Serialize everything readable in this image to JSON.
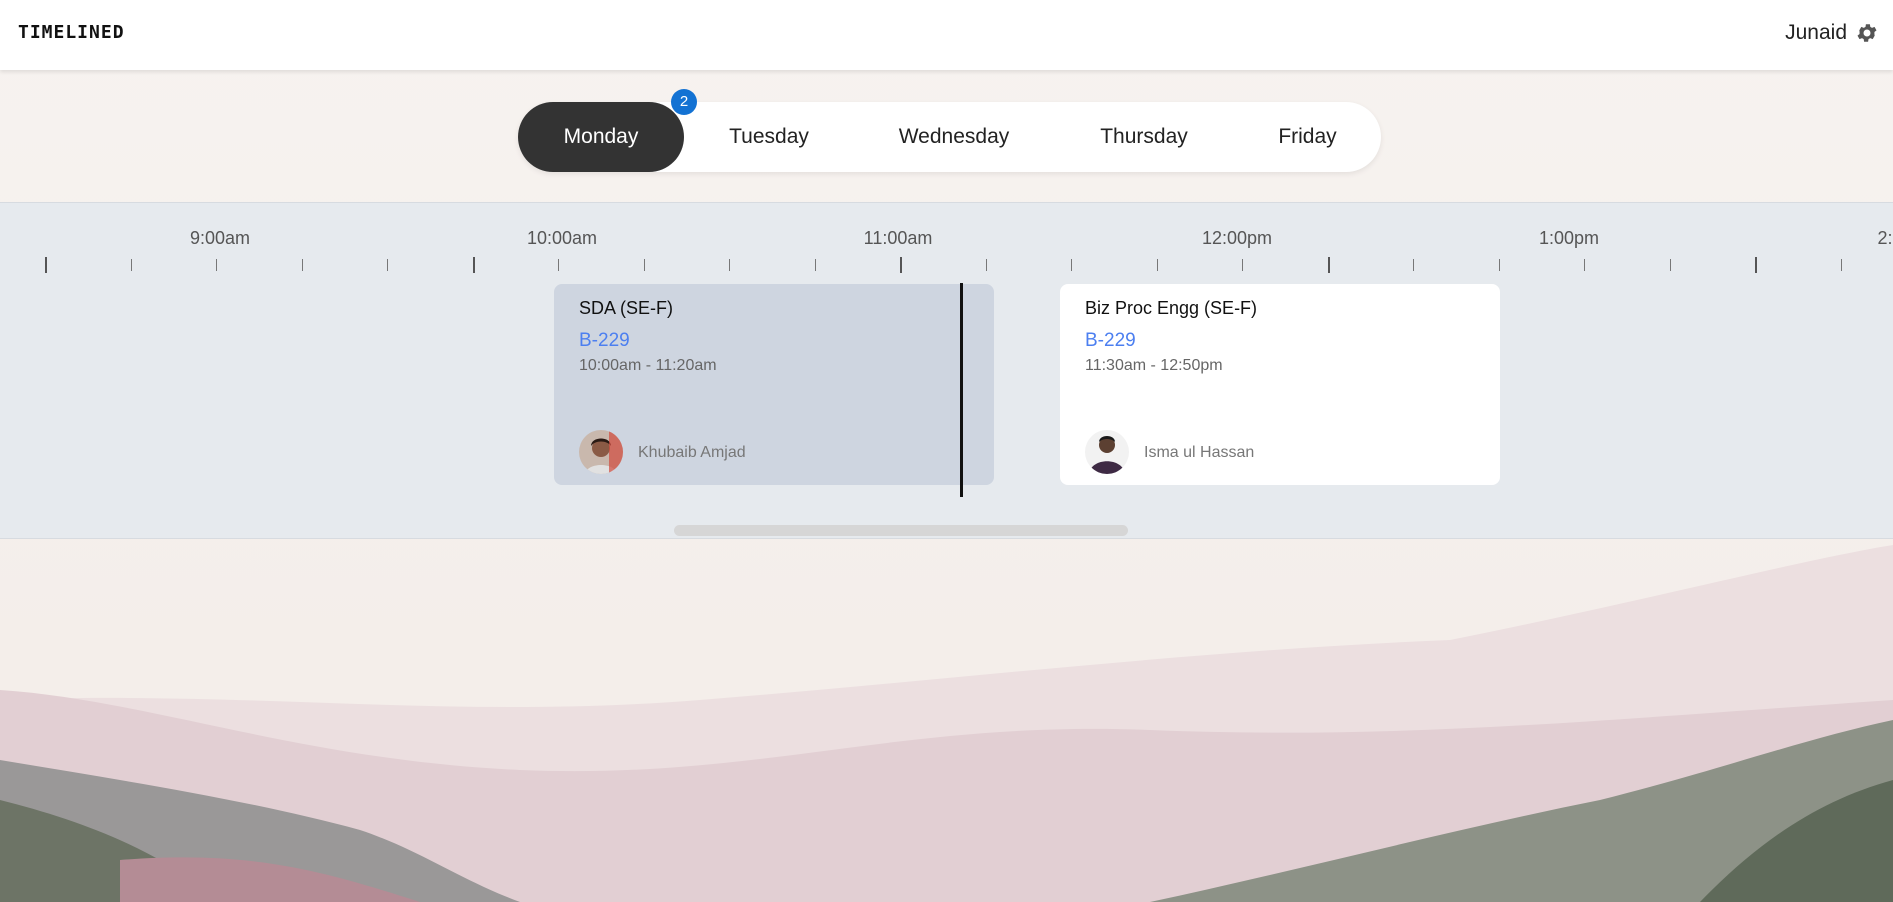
{
  "app": {
    "logo": "TIMELINED",
    "user_name": "Junaid",
    "settings_icon": "gear-icon"
  },
  "days": {
    "badge_count": "2",
    "tabs": [
      {
        "label": "Monday",
        "active": true
      },
      {
        "label": "Tuesday",
        "active": false
      },
      {
        "label": "Wednesday",
        "active": false
      },
      {
        "label": "Thursday",
        "active": false
      },
      {
        "label": "Friday",
        "active": false
      }
    ]
  },
  "timeline": {
    "hours": [
      "9:00am",
      "10:00am",
      "11:00am",
      "12:00pm",
      "1:00pm",
      "2:"
    ],
    "classes": [
      {
        "title": "SDA (SE-F)",
        "room": "B-229",
        "time": "10:00am - 11:20am",
        "teacher": "Khubaib Amjad",
        "state": "past"
      },
      {
        "title": "Biz Proc Engg (SE-F)",
        "room": "B-229",
        "time": "11:30am - 12:50pm",
        "teacher": "Isma ul Hassan",
        "state": "upcoming"
      }
    ]
  },
  "colors": {
    "active_tab": "#333333",
    "badge": "#1372d3",
    "room_link": "#4c7ff0",
    "timeline_bg": "#e6eaee",
    "past_card": "#ced5e0"
  }
}
